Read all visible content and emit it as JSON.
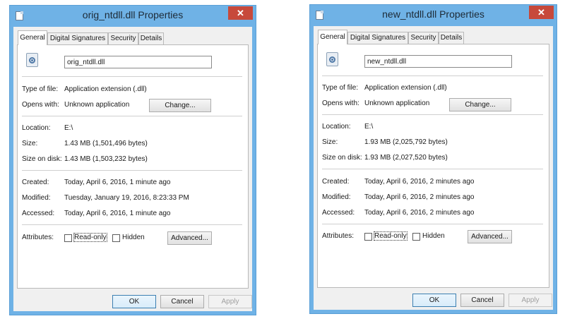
{
  "tabs": [
    "General",
    "Digital Signatures",
    "Security",
    "Details"
  ],
  "labels": {
    "type": "Type of file:",
    "opens": "Opens with:",
    "location": "Location:",
    "size": "Size:",
    "size_on_disk": "Size on disk:",
    "created": "Created:",
    "modified": "Modified:",
    "accessed": "Accessed:",
    "attributes": "Attributes:"
  },
  "buttons": {
    "change": "Change...",
    "advanced": "Advanced...",
    "ok": "OK",
    "cancel": "Cancel",
    "apply": "Apply",
    "close": "✕"
  },
  "checkboxes": {
    "readonly": "Read-only",
    "hidden": "Hidden"
  },
  "windows": [
    {
      "title": "orig_ntdll.dll Properties",
      "filename": "orig_ntdll.dll",
      "type": "Application extension (.dll)",
      "opens": "Unknown application",
      "location": "E:\\",
      "size": "1.43 MB (1,501,496 bytes)",
      "size_on_disk": "1.43 MB (1,503,232 bytes)",
      "created": "Today, April 6, 2016, 1 minute ago",
      "modified": "Tuesday, January 19, 2016, 8:23:33 PM",
      "accessed": "Today, April 6, 2016, 1 minute ago"
    },
    {
      "title": "new_ntdll.dll Properties",
      "filename": "new_ntdll.dll",
      "type": "Application extension (.dll)",
      "opens": "Unknown application",
      "location": "E:\\",
      "size": "1.93 MB (2,025,792 bytes)",
      "size_on_disk": "1.93 MB (2,027,520 bytes)",
      "created": "Today, April 6, 2016, 2 minutes ago",
      "modified": "Today, April 6, 2016, 2 minutes ago",
      "accessed": "Today, April 6, 2016, 2 minutes ago"
    }
  ]
}
